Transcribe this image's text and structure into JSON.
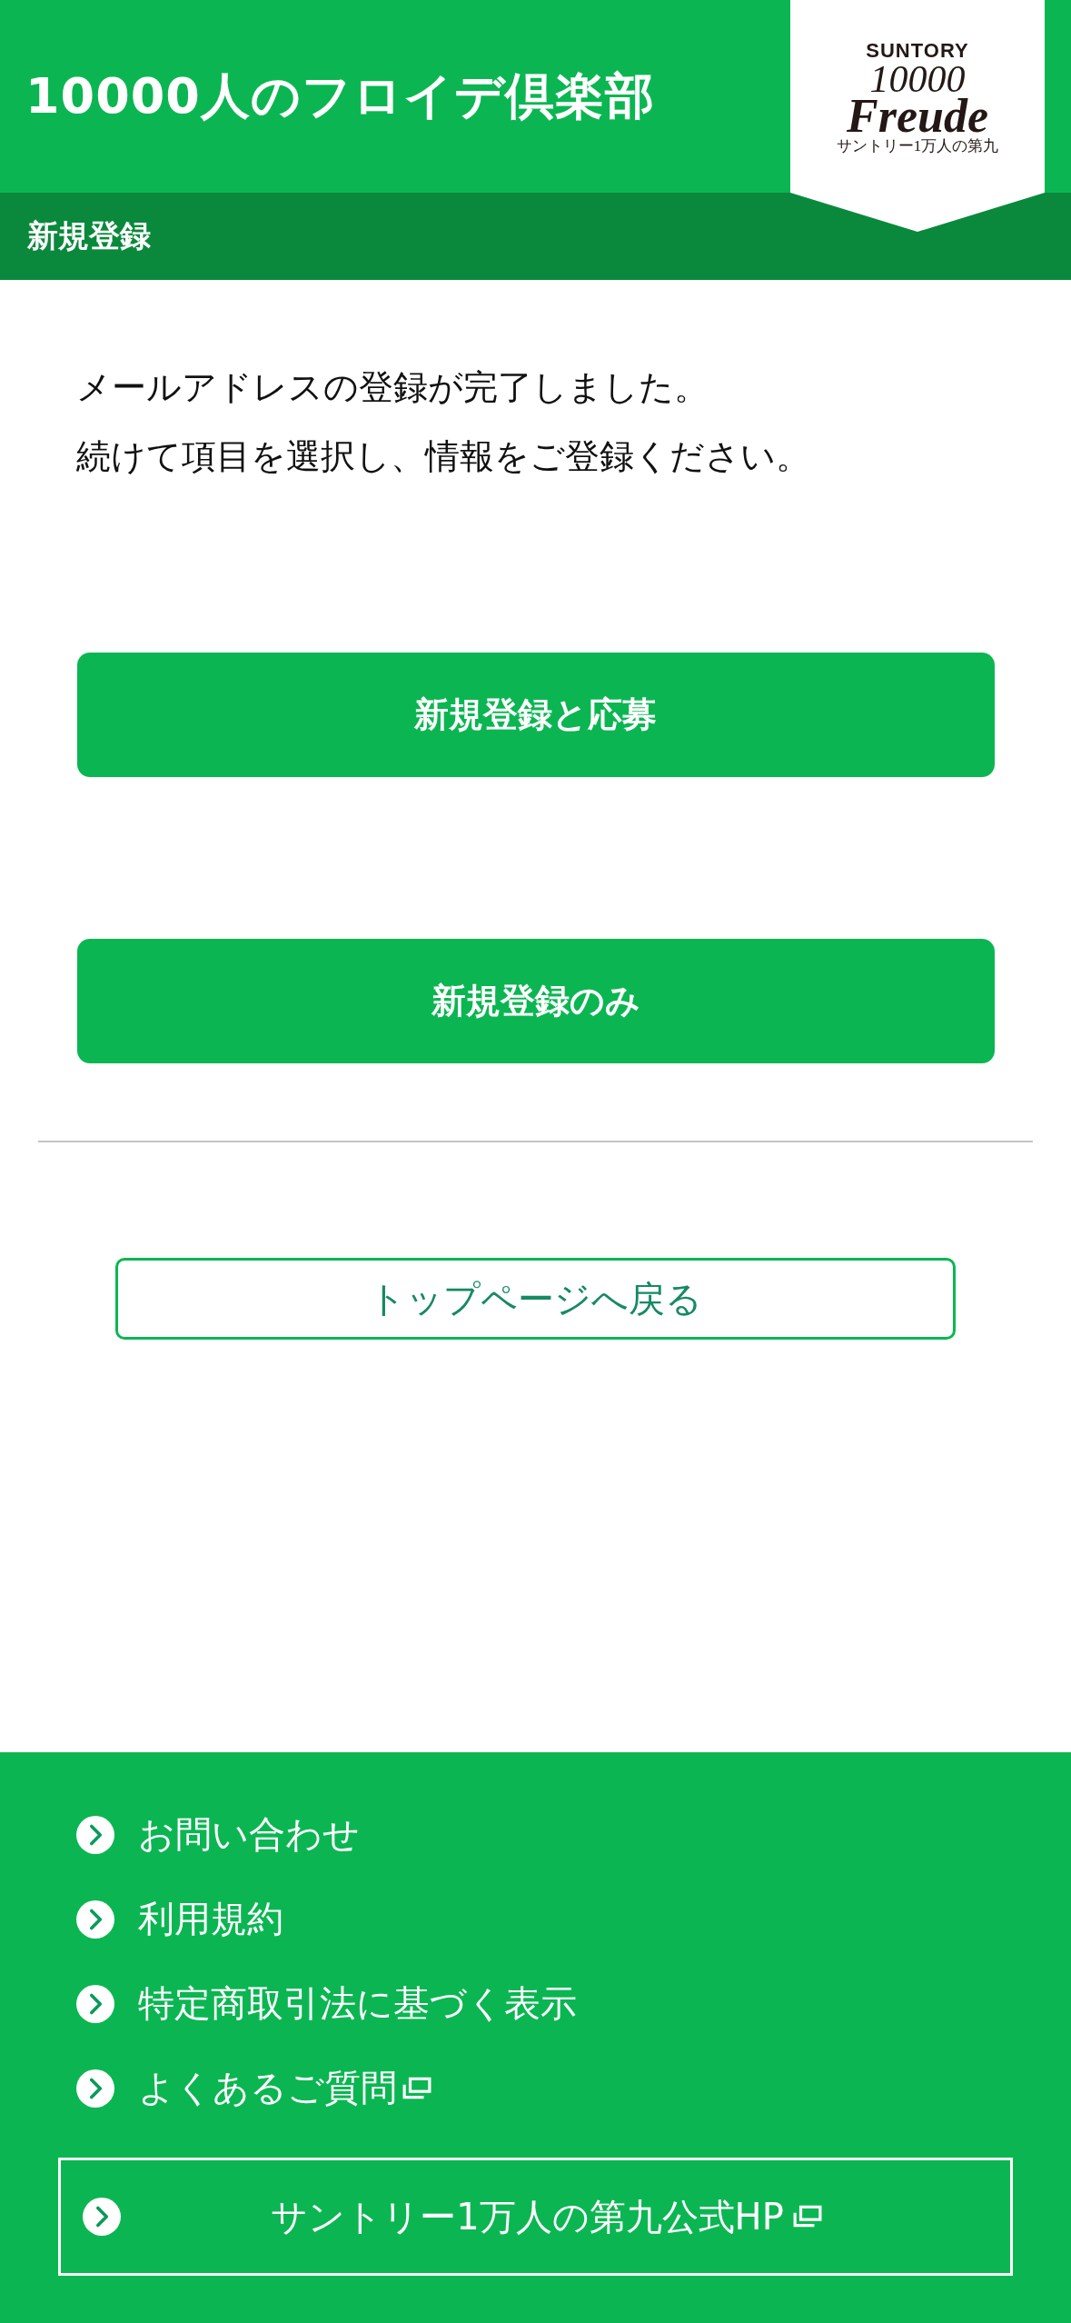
{
  "header": {
    "title": "10000人のフロイデ倶楽部",
    "logo": {
      "brand": "SUNTORY",
      "number": "10000",
      "word": "Freude",
      "subtitle": "サントリー1万人の第九"
    }
  },
  "subheader": {
    "title": "新規登録"
  },
  "message": [
    "メールアドレスの登録が完了しました。",
    "続けて項目を選択し、情報をご登録ください。"
  ],
  "actions": [
    {
      "label": "新規登録と応募"
    },
    {
      "label": "新規登録のみ"
    }
  ],
  "back_button": {
    "label": "トップページへ戻る"
  },
  "footer": {
    "links": [
      {
        "label": "お問い合わせ",
        "external": false
      },
      {
        "label": "利用規約",
        "external": false
      },
      {
        "label": "特定商取引法に基づく表示",
        "external": false
      },
      {
        "label": "よくあるご質問",
        "external": true
      }
    ],
    "official_link": {
      "label": "サントリー1万人の第九公式HP",
      "external": true
    }
  }
}
